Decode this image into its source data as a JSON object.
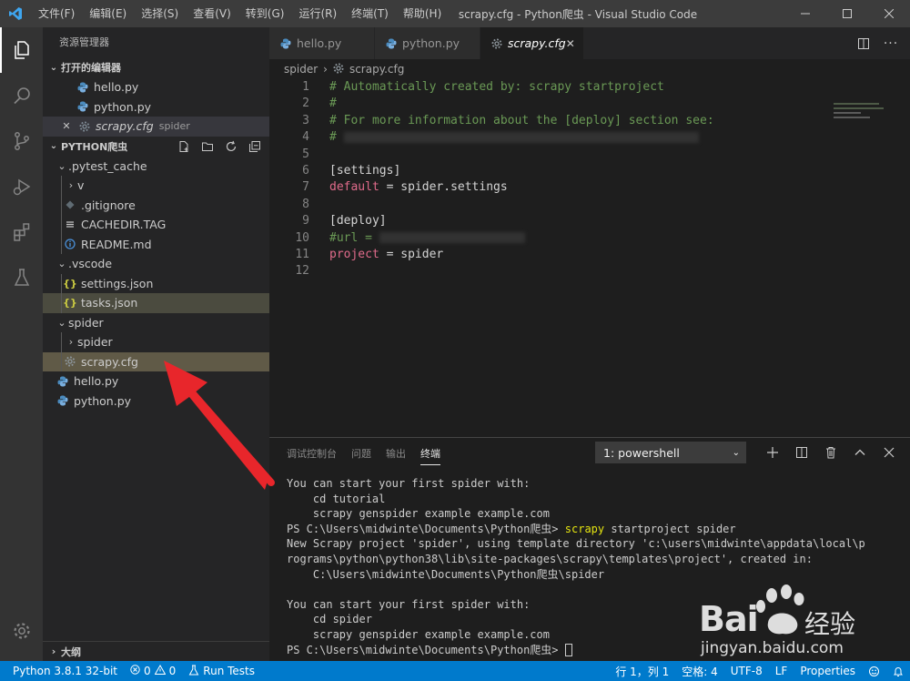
{
  "window": {
    "title": "scrapy.cfg - Python爬虫 - Visual Studio Code",
    "menu": [
      "文件(F)",
      "编辑(E)",
      "选择(S)",
      "查看(V)",
      "转到(G)",
      "运行(R)",
      "终端(T)",
      "帮助(H)"
    ]
  },
  "sidebar": {
    "title": "资源管理器",
    "open_editors_label": "打开的编辑器",
    "open_editors": [
      {
        "name": "hello.py",
        "icon": "python-file-icon"
      },
      {
        "name": "python.py",
        "icon": "python-file-icon"
      },
      {
        "name": "scrapy.cfg",
        "desc": "spider",
        "icon": "gear-file-icon"
      }
    ],
    "project_label": "PYTHON爬虫",
    "tree": [
      {
        "name": ".pytest_cache",
        "type": "folder-open"
      },
      {
        "name": "v",
        "type": "folder-closed"
      },
      {
        "name": ".gitignore",
        "type": "file"
      },
      {
        "name": "CACHEDIR.TAG",
        "type": "file"
      },
      {
        "name": "README.md",
        "type": "file"
      },
      {
        "name": ".vscode",
        "type": "folder-open"
      },
      {
        "name": "settings.json",
        "type": "file"
      },
      {
        "name": "tasks.json",
        "type": "file"
      },
      {
        "name": "spider",
        "type": "folder-open"
      },
      {
        "name": "spider",
        "type": "folder-closed"
      },
      {
        "name": "scrapy.cfg",
        "type": "file"
      },
      {
        "name": "hello.py",
        "type": "file"
      },
      {
        "name": "python.py",
        "type": "file"
      }
    ],
    "outline_label": "大纲"
  },
  "tabs": [
    {
      "label": "hello.py"
    },
    {
      "label": "python.py"
    },
    {
      "label": "scrapy.cfg"
    }
  ],
  "breadcrumb": {
    "folder": "spider",
    "file": "scrapy.cfg"
  },
  "code": {
    "line_numbers": [
      "1",
      "2",
      "3",
      "4",
      "5",
      "6",
      "7",
      "8",
      "9",
      "10",
      "11",
      "12"
    ],
    "l1": "# Automatically created by: scrapy startproject",
    "l2": "#",
    "l3": "# For more information about the [deploy] section see:",
    "l4": "#",
    "l6": "[settings]",
    "l7_key": "default",
    "l7_rest": " = spider.settings",
    "l9": "[deploy]",
    "l10": "#url = ",
    "l11_key": "project",
    "l11_rest": " = spider"
  },
  "panel": {
    "tabs": [
      "调试控制台",
      "问题",
      "输出",
      "终端"
    ],
    "terminal_selector": "1: powershell",
    "lines": [
      "You can start your first spider with:",
      "    cd tutorial",
      "    scrapy genspider example example.com"
    ],
    "prompt1": "PS C:\\Users\\midwinte\\Documents\\Python爬虫> ",
    "cmd_word": "scrapy",
    "cmd_rest": " startproject spider",
    "lines2": [
      "New Scrapy project 'spider', using template directory 'c:\\users\\midwinte\\appdata\\local\\p",
      "rograms\\python\\python38\\lib\\site-packages\\scrapy\\templates\\project', created in:",
      "    C:\\Users\\midwinte\\Documents\\Python爬虫\\spider",
      "",
      "You can start your first spider with:",
      "    cd spider",
      "    scrapy genspider example example.com"
    ],
    "prompt2": "PS C:\\Users\\midwinte\\Documents\\Python爬虫> "
  },
  "statusbar": {
    "python": "Python 3.8.1 32-bit",
    "errors": "0",
    "warnings": "0",
    "run_tests": "Run Tests",
    "position": "行 1，列 1",
    "spaces": "空格: 4",
    "encoding": "UTF-8",
    "eol": "LF",
    "language": "Properties"
  },
  "watermark": {
    "brand": "Bai",
    "cn": "经验",
    "url": "jingyan.baidu.com"
  },
  "colors": {
    "accent": "#007acc",
    "arrow": "#e8262b"
  }
}
